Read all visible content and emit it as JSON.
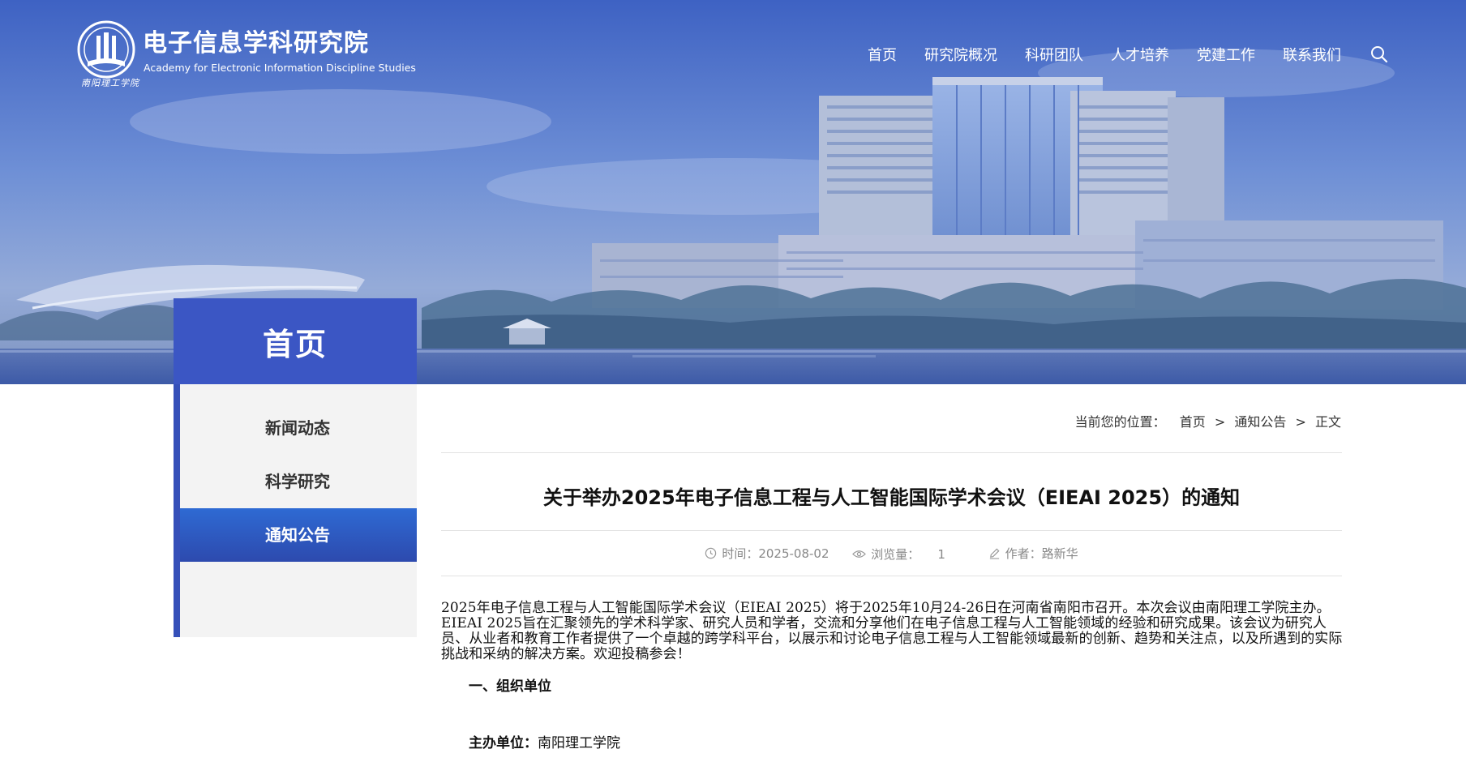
{
  "header": {
    "logo_title": "电子信息学科研究院",
    "logo_subtitle_en": "Academy for Electronic Information Discipline Studies",
    "logo_school_script": "南阳理工学院",
    "nav": [
      "首页",
      "研究院概况",
      "科研团队",
      "人才培养",
      "党建工作",
      "联系我们"
    ],
    "search_icon": "search-icon"
  },
  "sidebar": {
    "title": "首页",
    "items": [
      {
        "label": "新闻动态",
        "active": false
      },
      {
        "label": "科学研究",
        "active": false
      },
      {
        "label": "通知公告",
        "active": true
      }
    ]
  },
  "breadcrumb": {
    "label": "当前您的位置：",
    "items": [
      "首页",
      "通知公告",
      "正文"
    ],
    "separator": ">"
  },
  "article": {
    "title": "关于举办2025年电子信息工程与人工智能国际学术会议（EIEAI 2025）的通知",
    "meta": {
      "time_label": "时间：",
      "time_value": "2025-08-02",
      "views_label": "浏览量：",
      "views_value": "1",
      "author_label": "作者：",
      "author_value": "路新华"
    },
    "body": "2025年电子信息工程与人工智能国际学术会议（EIEAI 2025）将于2025年10月24-26日在河南省南阳市召开。本次会议由南阳理工学院主办。EIEAI 2025旨在汇聚领先的学术科学家、研究人员和学者，交流和分享他们在电子信息工程与人工智能领域的经验和研究成果。该会议为研究人员、从业者和教育工作者提供了一个卓越的跨学科平台，以展示和讨论电子信息工程与人工智能领域最新的创新、趋势和关注点，以及所遇到的实际挑战和采纳的解决方案。欢迎投稿参会！",
    "section_1_heading": "一、组织单位",
    "organizer_label": "主办单位：",
    "organizer_value": "南阳理工学院"
  },
  "colors": {
    "primary_blue": "#3b56c4",
    "active_menu": "#2e6ad3",
    "sidebar_bg": "#f3f3f3"
  }
}
